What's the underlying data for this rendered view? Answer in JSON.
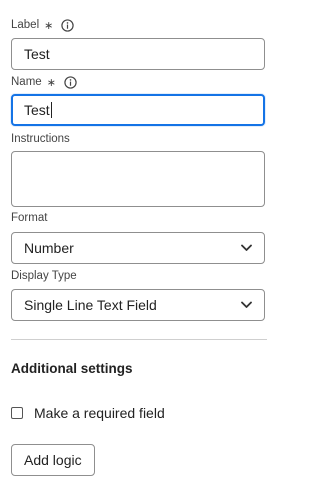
{
  "form": {
    "label_field": {
      "label": "Label",
      "required_mark": "∗",
      "value": "Test"
    },
    "name_field": {
      "label": "Name",
      "required_mark": "∗",
      "value": "Test"
    },
    "instructions_field": {
      "label": "Instructions",
      "value": ""
    },
    "format_field": {
      "label": "Format",
      "selected": "Number"
    },
    "display_type_field": {
      "label": "Display Type",
      "selected": "Single Line Text Field"
    }
  },
  "additional_settings": {
    "title": "Additional settings",
    "required_checkbox": {
      "label": "Make a required field",
      "checked": false
    },
    "add_logic_label": "Add logic"
  },
  "colors": {
    "focus": "#1473e6",
    "border": "#8f8f8f",
    "divider": "#cfcfcf"
  },
  "icons": {
    "info": "info-icon",
    "chevron": "chevron-down-icon"
  }
}
